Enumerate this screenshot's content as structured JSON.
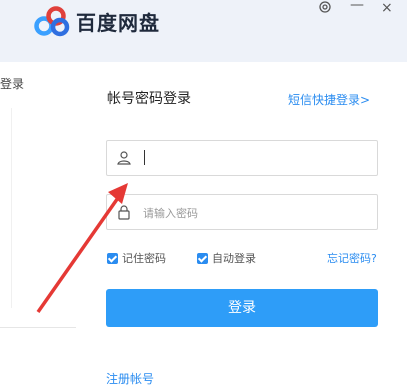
{
  "app": {
    "title": "百度网盘"
  },
  "window": {
    "settings_icon": "settings-icon",
    "minimize_label": "—",
    "close_label": "×"
  },
  "left_panel": {
    "label": "登录"
  },
  "login": {
    "title": "帐号密码登录",
    "quick_link": "短信快捷登录>",
    "account_value": "",
    "password_placeholder": "请输入密码",
    "remember_label": "记住密码",
    "remember_checked": true,
    "autologin_label": "自动登录",
    "autologin_checked": true,
    "forgot_label": "忘记密码?",
    "submit_label": "登录",
    "register_label": "注册帐号"
  },
  "colors": {
    "accent": "#2e9df8",
    "link": "#2a8cf0",
    "annotation_arrow": "#e53935"
  }
}
